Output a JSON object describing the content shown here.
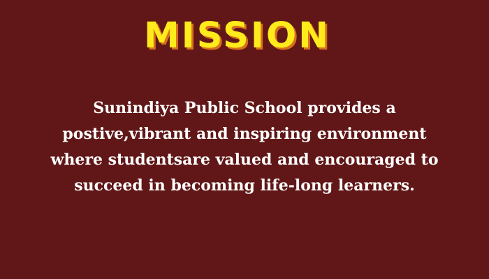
{
  "graphic": {
    "heading": "MISSION",
    "lines": [
      "Sunindiya Public School provides a",
      "postive,vibrant and inspiring environment",
      "where studentsare valued and encouraged to",
      "succeed in becoming life-long learners."
    ],
    "colors": {
      "background": "#611717",
      "heading": "#ffeb1c",
      "heading_shadow": "#d7701c",
      "text": "#ffffff"
    }
  }
}
